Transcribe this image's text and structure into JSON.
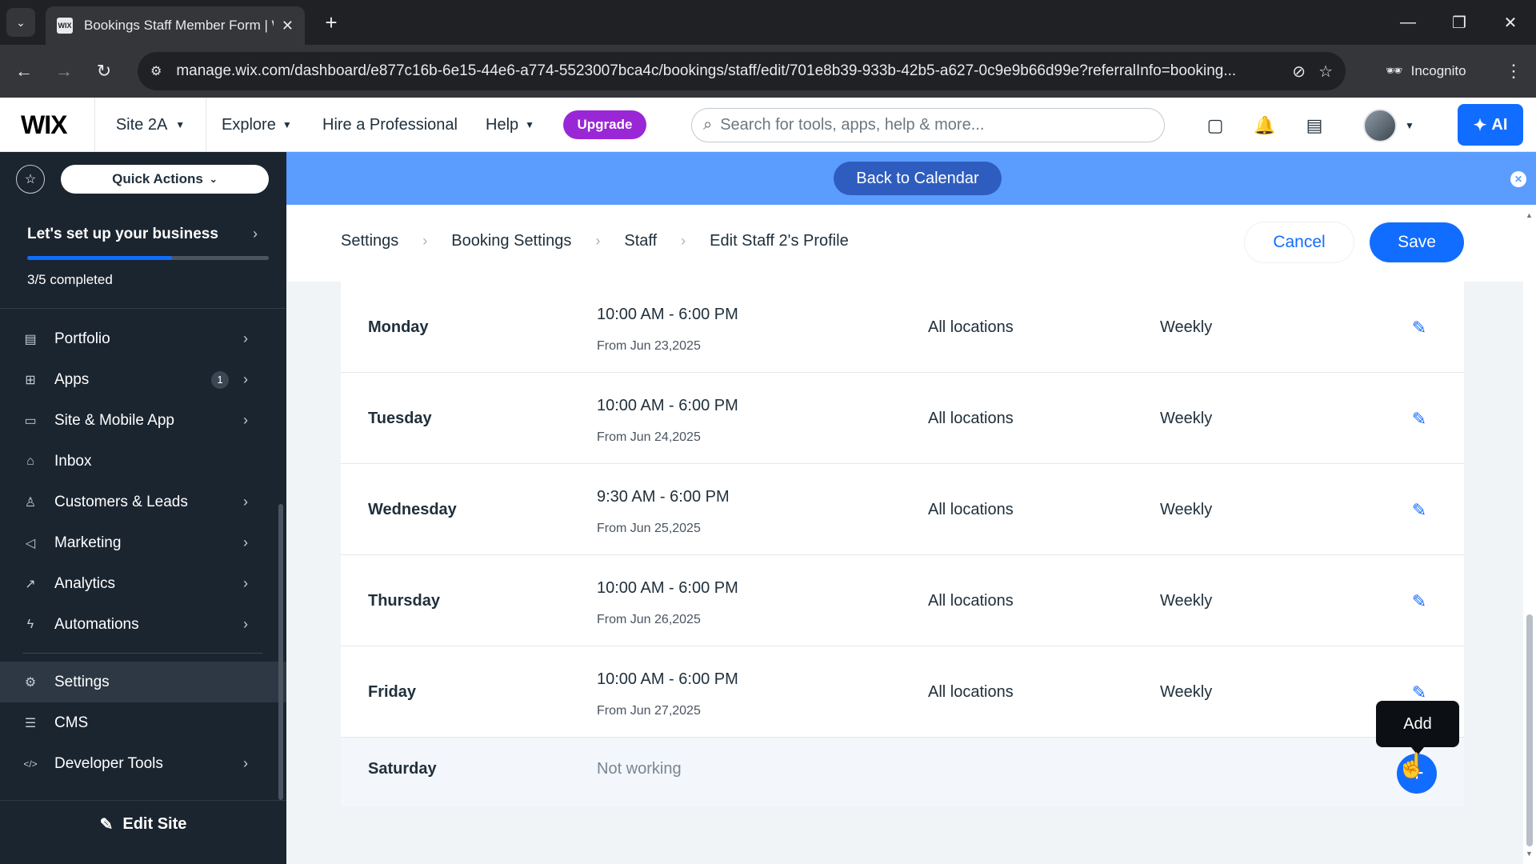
{
  "browser": {
    "tab_title": "Bookings Staff Member Form | W",
    "tab_favicon": "WIX",
    "url": "manage.wix.com/dashboard/e877c16b-6e15-44e6-a774-5523007bca4c/bookings/staff/edit/701e8b39-933b-42b5-a627-0c9e9b66d99e?referralInfo=booking...",
    "incognito_label": "Incognito"
  },
  "topbar": {
    "logo": "WIX",
    "site_name": "Site 2A",
    "explore": "Explore",
    "hire": "Hire a Professional",
    "help": "Help",
    "upgrade": "Upgrade",
    "search_placeholder": "Search for tools, apps, help & more...",
    "ai_label": "AI"
  },
  "sidebar": {
    "quick_actions": "Quick Actions",
    "setup_title": "Let's set up your business",
    "setup_progress": "3/5 completed",
    "progress_fraction": 0.6,
    "items": [
      {
        "label": "Portfolio",
        "icon": "portfolio-icon",
        "glyph": "▤",
        "chevron": true
      },
      {
        "label": "Apps",
        "icon": "apps-icon",
        "glyph": "⊞",
        "chevron": true,
        "badge": "1"
      },
      {
        "label": "Site & Mobile App",
        "icon": "site-mobile-icon",
        "glyph": "▭",
        "chevron": true
      },
      {
        "label": "Inbox",
        "icon": "inbox-icon",
        "glyph": "⌂",
        "chevron": false
      },
      {
        "label": "Customers & Leads",
        "icon": "customers-icon",
        "glyph": "♙",
        "chevron": true
      },
      {
        "label": "Marketing",
        "icon": "marketing-icon",
        "glyph": "◁",
        "chevron": true
      },
      {
        "label": "Analytics",
        "icon": "analytics-icon",
        "glyph": "↗",
        "chevron": true
      },
      {
        "label": "Automations",
        "icon": "automations-icon",
        "glyph": "ϟ",
        "chevron": true
      },
      {
        "label": "Settings",
        "icon": "settings-icon",
        "glyph": "⚙",
        "chevron": false,
        "active": true
      },
      {
        "label": "CMS",
        "icon": "cms-icon",
        "glyph": "☰",
        "chevron": false
      },
      {
        "label": "Developer Tools",
        "icon": "developer-tools-icon",
        "glyph": "</>",
        "chevron": true
      }
    ],
    "edit_site": "Edit Site"
  },
  "banner": {
    "back_to_calendar": "Back to Calendar"
  },
  "header": {
    "breadcrumb": [
      "Settings",
      "Booking Settings",
      "Staff"
    ],
    "current": "Edit Staff 2's Profile",
    "cancel": "Cancel",
    "save": "Save"
  },
  "schedule": {
    "rows": [
      {
        "day": "Monday",
        "hours": "10:00 AM - 6:00 PM",
        "from": "From Jun 23,2025",
        "location": "All locations",
        "frequency": "Weekly"
      },
      {
        "day": "Tuesday",
        "hours": "10:00 AM - 6:00 PM",
        "from": "From Jun 24,2025",
        "location": "All locations",
        "frequency": "Weekly"
      },
      {
        "day": "Wednesday",
        "hours": "9:30 AM - 6:00 PM",
        "from": "From Jun 25,2025",
        "location": "All locations",
        "frequency": "Weekly"
      },
      {
        "day": "Thursday",
        "hours": "10:00 AM - 6:00 PM",
        "from": "From Jun 26,2025",
        "location": "All locations",
        "frequency": "Weekly"
      },
      {
        "day": "Friday",
        "hours": "10:00 AM - 6:00 PM",
        "from": "From Jun 27,2025",
        "location": "All locations",
        "frequency": "Weekly"
      }
    ],
    "saturday": {
      "day": "Saturday",
      "status": "Not working"
    },
    "add_tooltip": "Add"
  },
  "colors": {
    "accent": "#116dff",
    "sidebar_bg": "#1b2530",
    "banner": "#5b9cff",
    "upgrade": "#9a27d5"
  }
}
